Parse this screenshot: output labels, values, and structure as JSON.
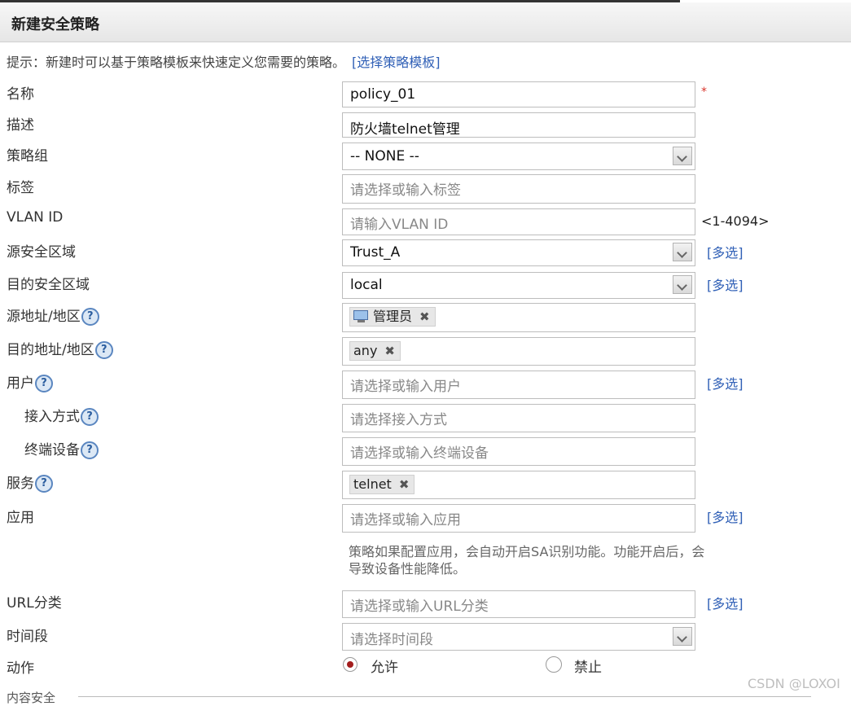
{
  "title": "新建安全策略",
  "hint": {
    "text": "提示：新建时可以基于策略模板来快速定义您需要的策略。",
    "link": "[选择策略模板]"
  },
  "fields": {
    "name": {
      "label": "名称",
      "value": "policy_01",
      "required_mark": "*"
    },
    "desc": {
      "label": "描述",
      "value": "防火墙telnet管理"
    },
    "group": {
      "label": "策略组",
      "value": "-- NONE --"
    },
    "tag": {
      "label": "标签",
      "placeholder": "请选择或输入标签"
    },
    "vlan": {
      "label": "VLAN ID",
      "placeholder": "请输入VLAN ID",
      "range": "<1-4094>"
    },
    "src_zone": {
      "label": "源安全区域",
      "value": "Trust_A",
      "multi": "[多选]"
    },
    "dst_zone": {
      "label": "目的安全区域",
      "value": "local",
      "multi": "[多选]"
    },
    "src_addr": {
      "label": "源地址/地区",
      "chip": "管理员"
    },
    "dst_addr": {
      "label": "目的地址/地区",
      "chip": "any"
    },
    "user": {
      "label": "用户",
      "placeholder": "请选择或输入用户",
      "multi": "[多选]"
    },
    "access": {
      "label": "接入方式",
      "placeholder": "请选择接入方式"
    },
    "device": {
      "label": "终端设备",
      "placeholder": "请选择或输入终端设备"
    },
    "service": {
      "label": "服务",
      "chip": "telnet"
    },
    "app": {
      "label": "应用",
      "placeholder": "请选择或输入应用",
      "multi": "[多选]",
      "note": "策略如果配置应用，会自动开启SA识别功能。功能开启后，会导致设备性能降低。"
    },
    "url": {
      "label": "URL分类",
      "placeholder": "请选择或输入URL分类",
      "multi": "[多选]"
    },
    "time": {
      "label": "时间段",
      "placeholder": "请选择时间段"
    },
    "action": {
      "label": "动作",
      "allow": "允许",
      "deny": "禁止"
    }
  },
  "help_glyph": "?",
  "remove_glyph": "✖",
  "bottom_section": "内容安全",
  "watermark": "CSDN @LOXOI"
}
